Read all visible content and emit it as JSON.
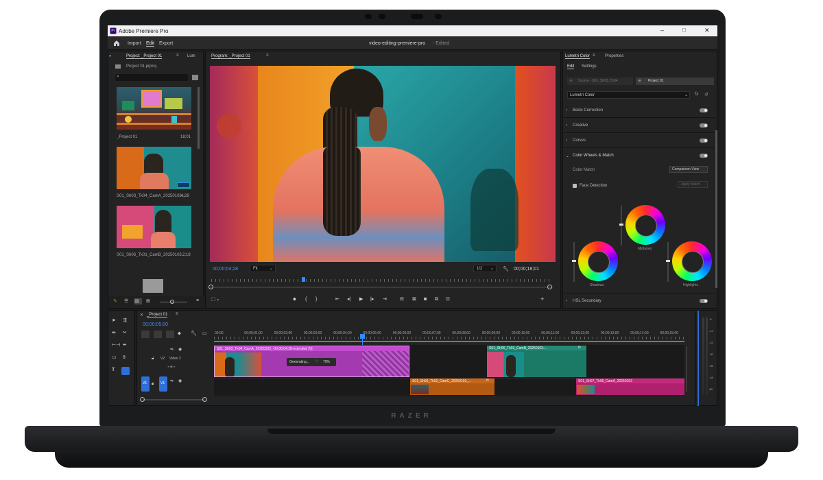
{
  "device": {
    "brand": "RAZER"
  },
  "window": {
    "app_title": "Adobe Premiere Pro",
    "logo_text": "Pr",
    "doc_title": "video-editing-premiere-pro",
    "doc_status": "- Edited"
  },
  "menu": {
    "items": [
      "Import",
      "Edit",
      "Export"
    ]
  },
  "project_panel": {
    "tabs": [
      "Project: _Project 01",
      "Lum"
    ],
    "file": "Project 01.prproj",
    "search_placeholder": "",
    "items": [
      {
        "name": "_Project 01",
        "duration": "18;01"
      },
      {
        "name": "S01_Sh03_Tk04_CamA_20250103...",
        "duration": "4;28"
      },
      {
        "name": "S01_Sh06_Tk01_CamB_20250103...",
        "duration": "2;18"
      }
    ]
  },
  "program_monitor": {
    "title": "Program: _Project 01",
    "current_time": "00;00;04;28",
    "zoom": "Fit",
    "resolution": "1/2",
    "duration": "00;00;18;01",
    "playhead": 0.27
  },
  "lumetri": {
    "tabs": [
      "Lumetri Color",
      "Properties"
    ],
    "subtabs": [
      "Edit",
      "Settings"
    ],
    "source_label": "Source - S01_Sh03_Tk04",
    "project_label": "Project 01",
    "effect_name": "Lumetri Color",
    "fx_label": "fx",
    "sections": [
      "Basic Correction",
      "Creative",
      "Curves",
      "Color Wheels & Match"
    ],
    "color_match_label": "Color Match",
    "comparison_view": "Comparison View",
    "face_detection": "Face Detection",
    "apply_match": "Apply Match",
    "wheels": [
      "Midtones",
      "Shadows",
      "Highlights"
    ],
    "hsl": "HSL Secondary"
  },
  "timeline": {
    "tab": "_Project 01",
    "timecode": "00;00;05;00",
    "ruler": [
      "00;00",
      "00;00;01;00",
      "00;00;02;00",
      "00;00;03;00",
      "00;00;04;00",
      "00;00;05;00",
      "00;00;06;00",
      "00;00;07;00",
      "00;00;08;00",
      "00;00;09;00",
      "00;00;10;00",
      "00;00;11;00",
      "00;00;12;00",
      "00;00;13;00",
      "00;00;14;00",
      "00;00;15;00"
    ],
    "tracks": {
      "v2_id": "V2",
      "v2_name": "Video 2",
      "v1_src": "V1",
      "v1_dst": "V1"
    },
    "clips": {
      "c1": "S01_Sh03_Tk04_CamA_20250103_-00;00;04;28-extended [V]",
      "generating": "Generating...",
      "progress": "70%",
      "c2": "S01_Sh06_Tk01_CamB_20250103...",
      "c3": "S01_Sh05_Tk02_CamC_20250103_...",
      "c4": "S01_Sh07_Tk08_CamA_20250103",
      "fx": "fx"
    },
    "meter_labels": [
      "-6",
      "-12",
      "-24",
      "-30",
      "-36",
      "-48",
      "dB"
    ]
  }
}
